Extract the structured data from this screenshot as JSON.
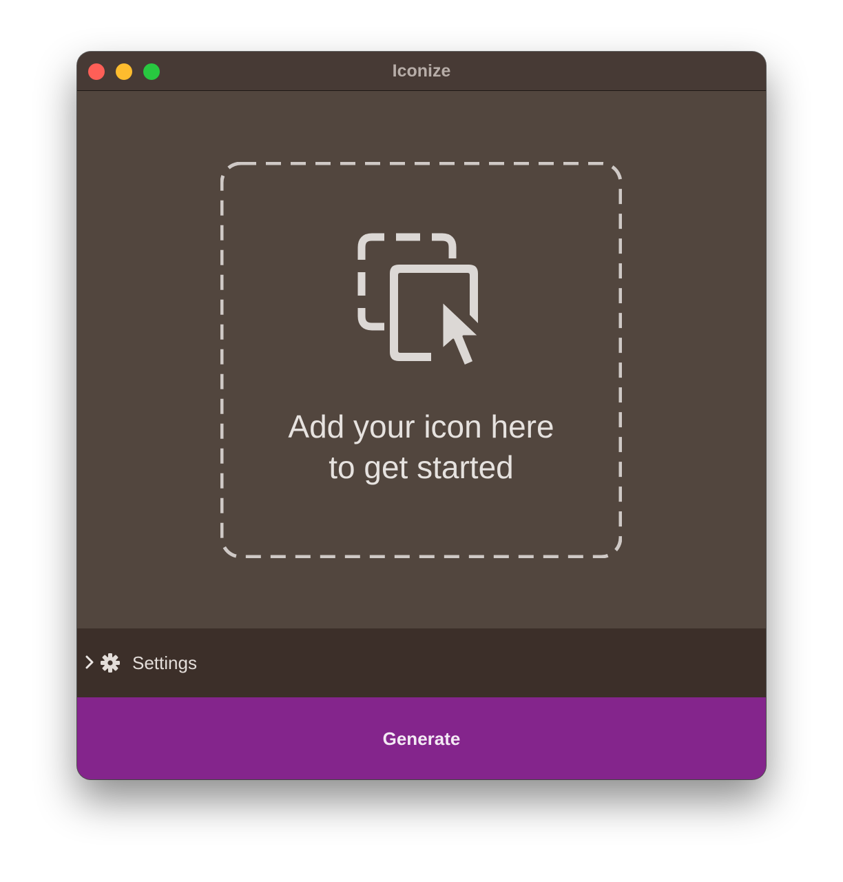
{
  "window": {
    "title": "Iconize",
    "traffic_lights": [
      "close",
      "minimize",
      "zoom"
    ]
  },
  "dropzone": {
    "icon": "drag-drop-icon",
    "line1": "Add your icon here",
    "line2": "to get started"
  },
  "settings": {
    "chevron_icon": "chevron-right-icon",
    "gear_icon": "gear-icon",
    "label": "Settings"
  },
  "generate": {
    "label": "Generate"
  },
  "colors": {
    "titlebar": "#473a35",
    "content": "#52463e",
    "settings_bar": "#3c2f29",
    "accent": "#84258c"
  }
}
